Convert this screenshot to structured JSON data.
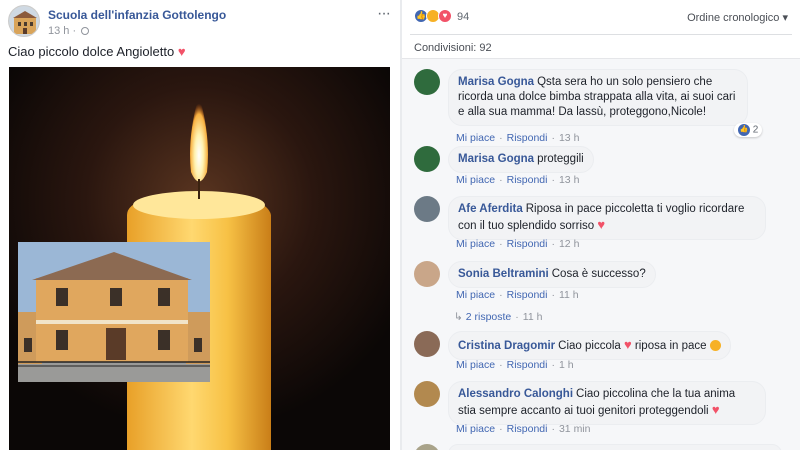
{
  "post": {
    "page_name": "Scuola dell'infanzia Gottolengo",
    "time": "13 h",
    "more_label": "···",
    "text": "Ciao piccolo dolce Angioletto",
    "heart": "♥"
  },
  "reactions": {
    "count": "94",
    "icons": [
      "like-icon",
      "sad-icon",
      "love-icon"
    ],
    "sort_label": "Ordine cronologico ▾",
    "shares": "Condivisioni: 92"
  },
  "comments": [
    {
      "name": "Marisa Gogna",
      "text": "Qsta sera ho un solo pensiero che ricorda una dolce bimba strappata alla vita, ai suoi cari e alla sua mamma! Da lassù, proteggono,Nicole!",
      "like_label": "Mi piace",
      "reply_label": "Rispondi",
      "time": "13 h",
      "likes": "2",
      "avatar_color": "#2f6b3d"
    },
    {
      "name": "Marisa Gogna",
      "text": "proteggili",
      "like_label": "Mi piace",
      "reply_label": "Rispondi",
      "time": "13 h",
      "avatar_color": "#2f6b3d"
    },
    {
      "name": "Afe Aferdita",
      "text": "Riposa in pace piccoletta ti voglio ricordare con il tuo splendido sorriso",
      "heart": "♥",
      "like_label": "Mi piace",
      "reply_label": "Rispondi",
      "time": "12 h",
      "avatar_color": "#6c7a86"
    },
    {
      "name": "Sonia Beltramini",
      "text": "Cosa è successo?",
      "like_label": "Mi piace",
      "reply_label": "Rispondi",
      "time": "11 h",
      "replies_label": "2 risposte",
      "replies_time": "11 h",
      "avatar_color": "#c9a689"
    },
    {
      "name": "Cristina Dragomir",
      "text_a": "Ciao piccola",
      "heart": "♥",
      "text_b": "riposa in pace",
      "like_label": "Mi piace",
      "reply_label": "Rispondi",
      "time": "1 h",
      "avatar_color": "#8a6a57"
    },
    {
      "name": "Alessandro Calonghi",
      "text": "Ciao piccolina che la tua anima stia sempre accanto ai tuoi genitori proteggendoli",
      "heart": "♥",
      "like_label": "Mi piace",
      "reply_label": "Rispondi",
      "time": "31 min",
      "avatar_color": "#b2894f"
    }
  ],
  "colors": {
    "brand": "#385898",
    "link": "#4267b2",
    "heart": "#f25268"
  }
}
